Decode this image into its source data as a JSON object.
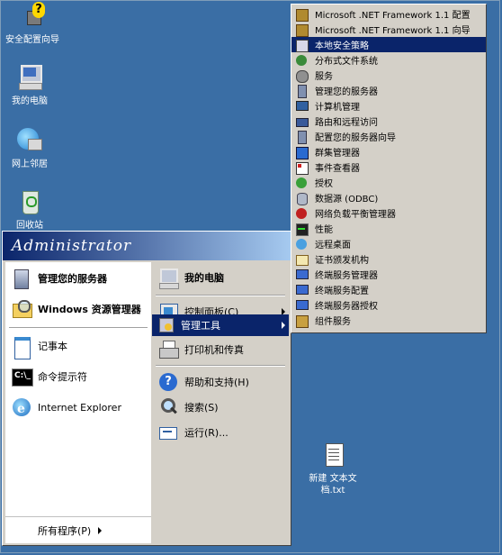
{
  "desktop": {
    "icons": [
      {
        "label": "安全配置向导",
        "icon": "security-wizard-icon"
      },
      {
        "label": "我的电脑",
        "icon": "my-computer-icon"
      },
      {
        "label": "网上邻居",
        "icon": "network-places-icon"
      },
      {
        "label": "回收站",
        "icon": "recycle-bin-icon"
      },
      {
        "label": "新建 文本文档.txt",
        "icon": "text-file-icon"
      }
    ]
  },
  "start_menu": {
    "user": "Administrator",
    "left": [
      {
        "label": "管理您的服务器",
        "icon": "manage-server-icon"
      },
      {
        "label": "Windows 资源管理器",
        "icon": "explorer-icon"
      },
      {
        "label": "记事本",
        "icon": "notepad-icon"
      },
      {
        "label": "命令提示符",
        "icon": "cmd-icon"
      },
      {
        "label": "Internet Explorer",
        "icon": "ie-icon"
      }
    ],
    "all_programs": "所有程序(P)",
    "right": [
      {
        "label": "我的电脑",
        "icon": "my-computer-icon"
      },
      {
        "label": "控制面板(C)",
        "icon": "control-panel-icon"
      },
      {
        "label": "管理工具",
        "icon": "admin-tools-icon"
      },
      {
        "label": "打印机和传真",
        "icon": "printer-icon"
      },
      {
        "label": "帮助和支持(H)",
        "icon": "help-icon"
      },
      {
        "label": "搜索(S)",
        "icon": "search-icon"
      },
      {
        "label": "运行(R)...",
        "icon": "run-icon"
      }
    ]
  },
  "admin_tools_menu": {
    "items": [
      {
        "label": "Microsoft .NET Framework 1.1 配置",
        "icon": "dotnet-config-icon"
      },
      {
        "label": "Microsoft .NET Framework 1.1 向导",
        "icon": "dotnet-wizard-icon"
      },
      {
        "label": "本地安全策略",
        "icon": "local-security-policy-icon"
      },
      {
        "label": "分布式文件系统",
        "icon": "dfs-icon"
      },
      {
        "label": "服务",
        "icon": "services-icon"
      },
      {
        "label": "管理您的服务器",
        "icon": "manage-server-icon"
      },
      {
        "label": "计算机管理",
        "icon": "computer-management-icon"
      },
      {
        "label": "路由和远程访问",
        "icon": "routing-icon"
      },
      {
        "label": "配置您的服务器向导",
        "icon": "configure-server-icon"
      },
      {
        "label": "群集管理器",
        "icon": "cluster-icon"
      },
      {
        "label": "事件查看器",
        "icon": "event-viewer-icon"
      },
      {
        "label": "授权",
        "icon": "licensing-icon"
      },
      {
        "label": "数据源 (ODBC)",
        "icon": "odbc-icon"
      },
      {
        "label": "网络负载平衡管理器",
        "icon": "nlb-icon"
      },
      {
        "label": "性能",
        "icon": "performance-icon"
      },
      {
        "label": "远程桌面",
        "icon": "remote-desktop-icon"
      },
      {
        "label": "证书颁发机构",
        "icon": "certificate-authority-icon"
      },
      {
        "label": "终端服务管理器",
        "icon": "ts-manager-icon"
      },
      {
        "label": "终端服务配置",
        "icon": "ts-config-icon"
      },
      {
        "label": "终端服务器授权",
        "icon": "ts-licensing-icon"
      },
      {
        "label": "组件服务",
        "icon": "component-services-icon"
      }
    ]
  },
  "colors": {
    "desktop": "#3a6ea5",
    "highlight": "#0a246a",
    "menu": "#d4d0c8"
  }
}
